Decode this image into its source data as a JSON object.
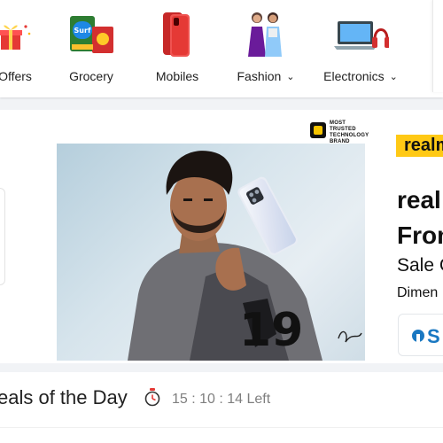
{
  "categories": [
    {
      "label": "Offers",
      "icon": "gift-icon",
      "chevron": false
    },
    {
      "label": "Grocery",
      "icon": "grocery-pack-icon",
      "chevron": false
    },
    {
      "label": "Mobiles",
      "icon": "smartphone-icon",
      "chevron": false
    },
    {
      "label": "Fashion",
      "icon": "fashion-models-icon",
      "chevron": true
    },
    {
      "label": "Electronics",
      "icon": "laptop-headphones-icon",
      "chevron": true
    }
  ],
  "chevron_glyph": "⌄",
  "banner": {
    "trust_badge": [
      "MOST TRUSTED",
      "TECHNOLOGY",
      "BRAND"
    ],
    "brand_logo": "realme",
    "headline_line1": "real",
    "headline_line2": "From",
    "subtitle": "Sale C",
    "detail": "Dimen",
    "bank_text": "S",
    "phone_back_text": "19"
  },
  "deals": {
    "title": "eals of the Day",
    "timer": "15 : 10 : 14 Left"
  },
  "colors": {
    "accent_yellow": "#ffc915",
    "bank_blue": "#1a78c2",
    "timer_red": "#e53935"
  }
}
